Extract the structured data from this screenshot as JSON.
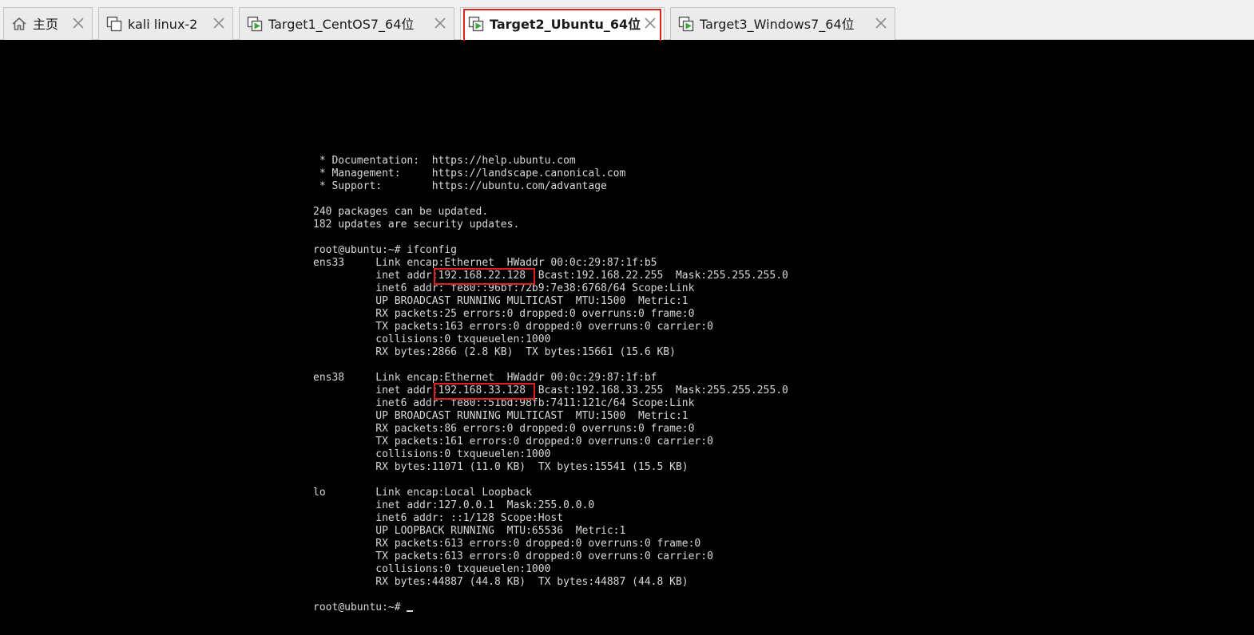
{
  "tabs": [
    {
      "label": "主页",
      "icon": "home-icon",
      "active": false
    },
    {
      "label": "kali linux-2",
      "icon": "vm-stack-icon",
      "active": false
    },
    {
      "label": "Target1_CentOS7_64位",
      "icon": "vm-running-icon",
      "active": false
    },
    {
      "label": "Target2_Ubuntu_64位",
      "icon": "vm-running-icon",
      "active": true
    },
    {
      "label": "Target3_Windows7_64位",
      "icon": "vm-running-icon",
      "active": false
    }
  ],
  "colors": {
    "highlight": "#e02020",
    "running_icon": "#3aa63a",
    "terminal_bg": "#000000",
    "terminal_fg": "#d8d8d8"
  },
  "terminal": {
    "lines": [
      " * Documentation:  https://help.ubuntu.com",
      " * Management:     https://landscape.canonical.com",
      " * Support:        https://ubuntu.com/advantage",
      "",
      "240 packages can be updated.",
      "182 updates are security updates.",
      "",
      "root@ubuntu:~# ifconfig",
      "ens33     Link encap:Ethernet  HWaddr 00:0c:29:87:1f:b5",
      {
        "pre": "          inet addr:",
        "addr": "192.168.22.128",
        "post": "  Bcast:192.168.22.255  Mask:255.255.255.0"
      },
      "          inet6 addr: fe80::96bf:72b9:7e38:6768/64 Scope:Link",
      "          UP BROADCAST RUNNING MULTICAST  MTU:1500  Metric:1",
      "          RX packets:25 errors:0 dropped:0 overruns:0 frame:0",
      "          TX packets:163 errors:0 dropped:0 overruns:0 carrier:0",
      "          collisions:0 txqueuelen:1000",
      "          RX bytes:2866 (2.8 KB)  TX bytes:15661 (15.6 KB)",
      "",
      "ens38     Link encap:Ethernet  HWaddr 00:0c:29:87:1f:bf",
      {
        "pre": "          inet addr:",
        "addr": "192.168.33.128",
        "post": "  Bcast:192.168.33.255  Mask:255.255.255.0"
      },
      "          inet6 addr: fe80::51bd:98fb:7411:121c/64 Scope:Link",
      "          UP BROADCAST RUNNING MULTICAST  MTU:1500  Metric:1",
      "          RX packets:86 errors:0 dropped:0 overruns:0 frame:0",
      "          TX packets:161 errors:0 dropped:0 overruns:0 carrier:0",
      "          collisions:0 txqueuelen:1000",
      "          RX bytes:11071 (11.0 KB)  TX bytes:15541 (15.5 KB)",
      "",
      "lo        Link encap:Local Loopback",
      "          inet addr:127.0.0.1  Mask:255.0.0.0",
      "          inet6 addr: ::1/128 Scope:Host",
      "          UP LOOPBACK RUNNING  MTU:65536  Metric:1",
      "          RX packets:613 errors:0 dropped:0 overruns:0 frame:0",
      "          TX packets:613 errors:0 dropped:0 overruns:0 carrier:0",
      "          collisions:0 txqueuelen:1000",
      "          RX bytes:44887 (44.8 KB)  TX bytes:44887 (44.8 KB)",
      "",
      "root@ubuntu:~# "
    ]
  }
}
